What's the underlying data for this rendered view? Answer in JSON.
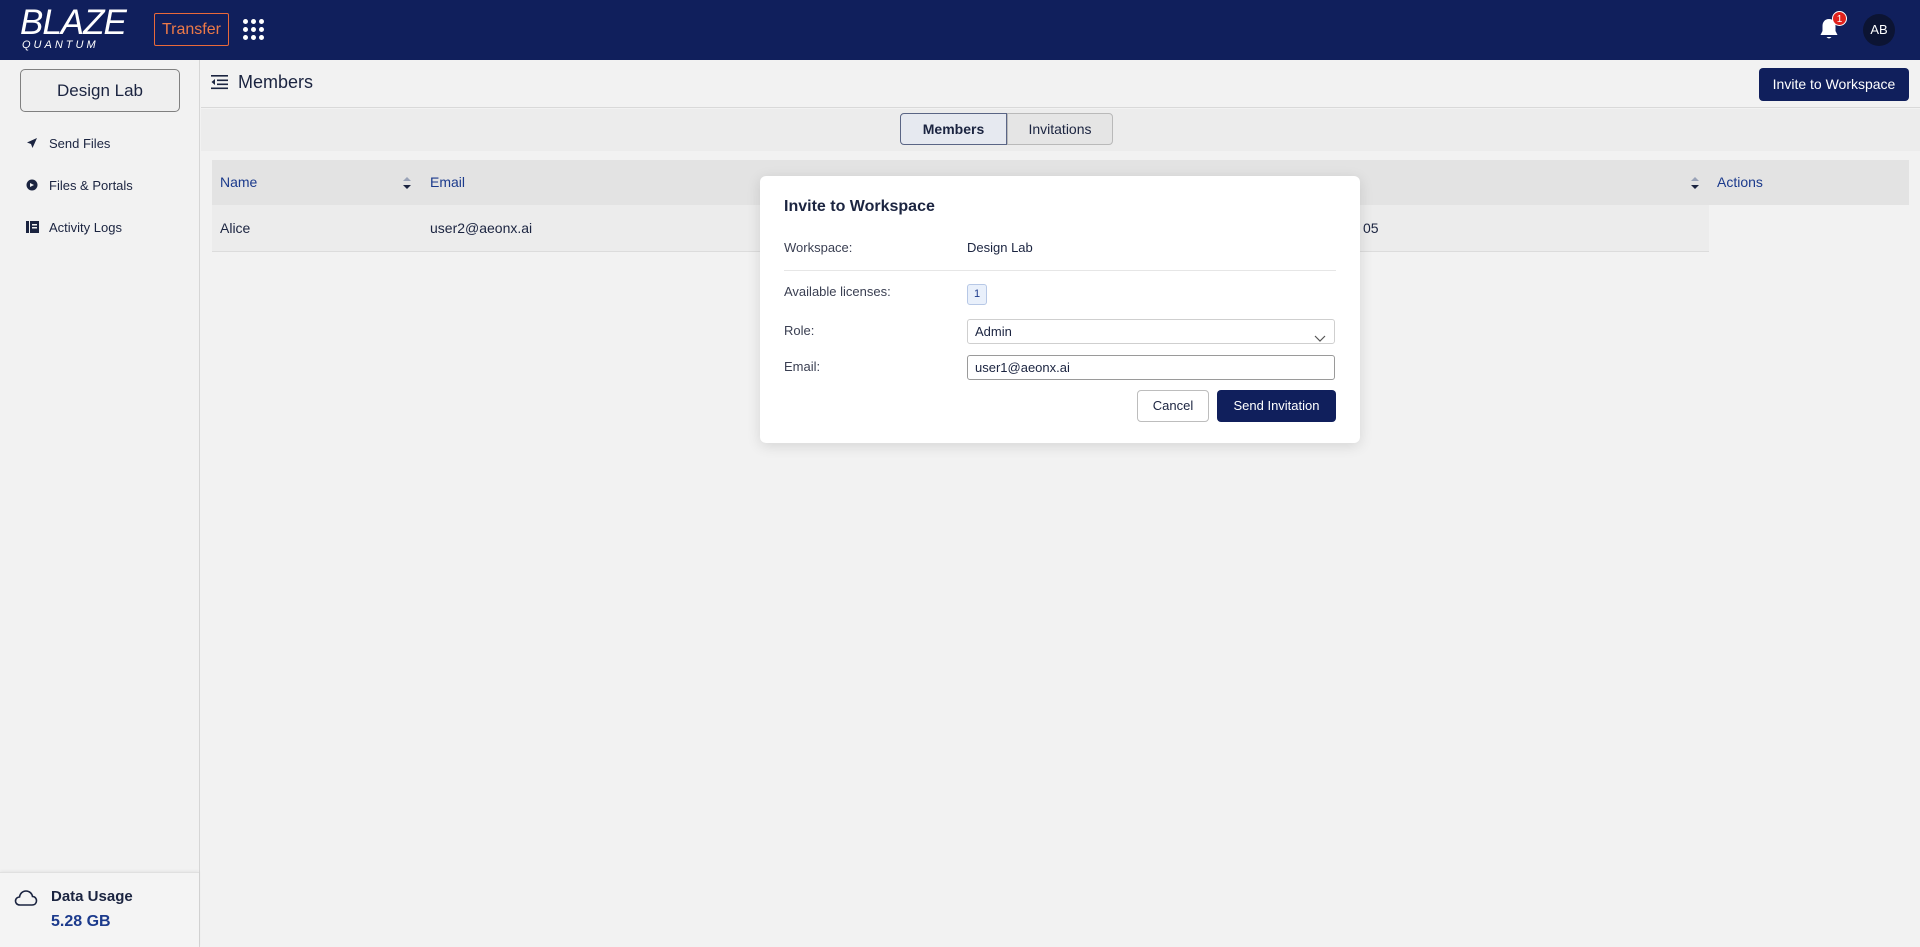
{
  "topbar": {
    "logo_main": "BLAZE",
    "logo_sub": "QUANTUM",
    "transfer_label": "Transfer",
    "notification_count": "1",
    "avatar_initials": "AB"
  },
  "sidebar": {
    "workspace_name": "Design Lab",
    "items": [
      {
        "label": "Send Files",
        "icon": "send-icon"
      },
      {
        "label": "Files & Portals",
        "icon": "portal-icon"
      },
      {
        "label": "Activity Logs",
        "icon": "logs-icon"
      }
    ],
    "usage": {
      "title": "Data Usage",
      "value": "5.28 GB"
    }
  },
  "header": {
    "title": "Members",
    "invite_button": "Invite to Workspace"
  },
  "tabs": [
    {
      "label": "Members",
      "active": true
    },
    {
      "label": "Invitations",
      "active": false
    }
  ],
  "table": {
    "columns": [
      "Name",
      "Email",
      "Actions"
    ],
    "rows": [
      {
        "name": "Alice",
        "email": "user2@aeonx.ai",
        "partial": "05"
      }
    ]
  },
  "modal": {
    "title": "Invite to Workspace",
    "workspace_label": "Workspace:",
    "workspace_value": "Design Lab",
    "licenses_label": "Available licenses:",
    "licenses_value": "1",
    "role_label": "Role:",
    "role_value": "Admin",
    "email_label": "Email:",
    "email_value": "user1@aeonx.ai",
    "cancel_label": "Cancel",
    "send_label": "Send Invitation"
  },
  "colors": {
    "brand_navy": "#101f5c",
    "accent_orange": "#ee7a48",
    "badge_red": "#e0221c"
  }
}
